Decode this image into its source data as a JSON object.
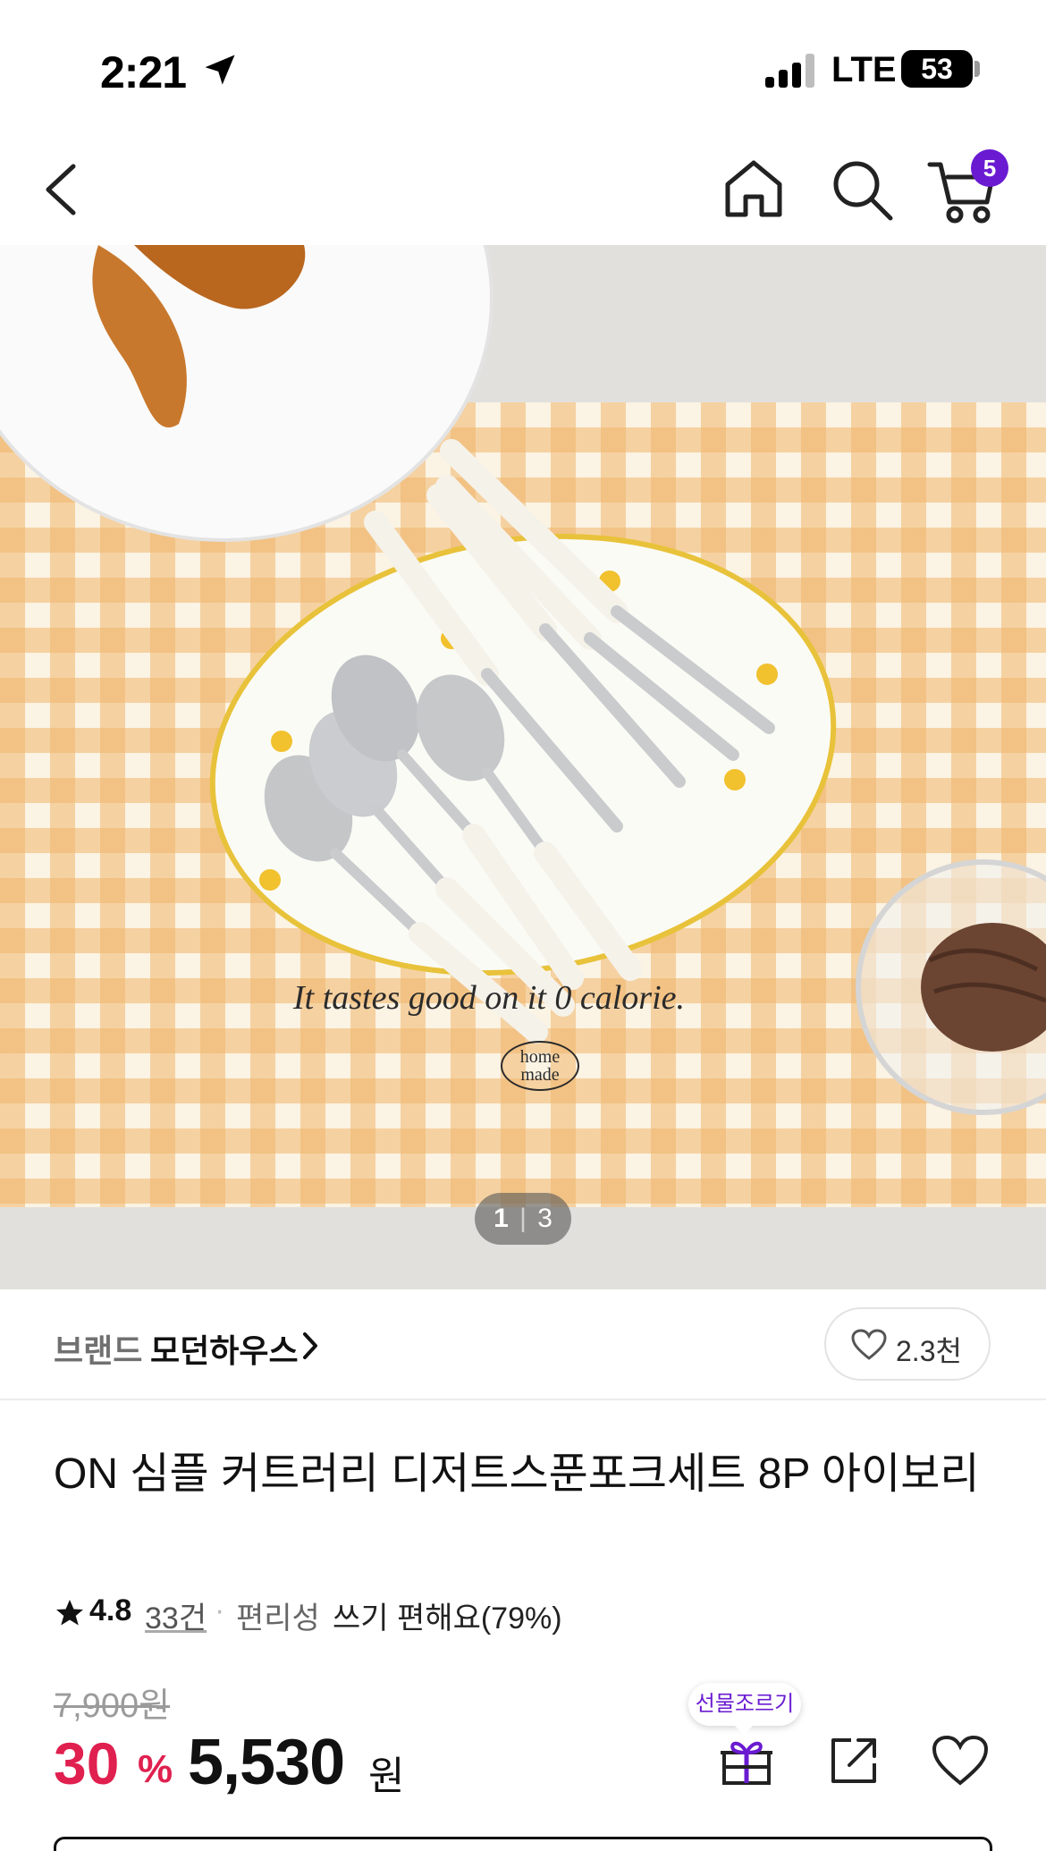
{
  "status_bar": {
    "time": "2:21",
    "network": "LTE",
    "battery": "53"
  },
  "nav": {
    "cart_count": "5"
  },
  "gallery": {
    "current_page": "1",
    "separator": "|",
    "total_pages": "3",
    "mat_caption": "It tastes good on it 0 calorie.",
    "mat_logo": "home made"
  },
  "brand": {
    "label": "브랜드",
    "name": "모던하우스",
    "like_count": "2.3천"
  },
  "product": {
    "title": "ON 심플 커트러리 디저트스푼포크세트 8P 아이보리"
  },
  "rating": {
    "score": "4.8",
    "review_count": "33건",
    "feature_label": "편리성",
    "feature_value": "쓰기 편해요(79%)"
  },
  "price": {
    "original": "7,900원",
    "discount_rate": "30",
    "discount_unit": "%",
    "sale": "5,530",
    "currency": "원"
  },
  "actions": {
    "gift_label": "선물조르기"
  },
  "colors": {
    "accent_purple": "#6a1bd1",
    "discount_red": "#e0204f"
  }
}
